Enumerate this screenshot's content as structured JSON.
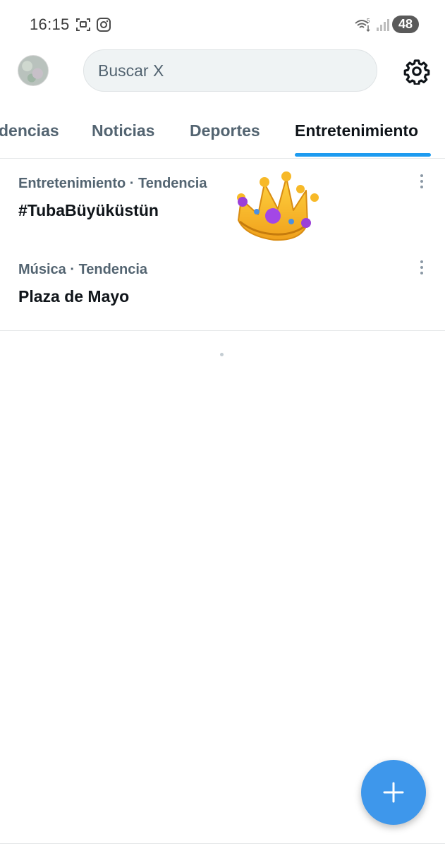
{
  "status_bar": {
    "time": "16:15",
    "battery": "48",
    "icons": [
      "screenshot-icon",
      "instagram-icon",
      "wifi-icon",
      "signal-icon"
    ]
  },
  "header": {
    "search_placeholder": "Buscar X",
    "settings_icon": "gear-icon"
  },
  "tabs": [
    {
      "label": "Tendencias",
      "visible_text": "dencias",
      "active": false
    },
    {
      "label": "Noticias",
      "visible_text": "Noticias",
      "active": false
    },
    {
      "label": "Deportes",
      "visible_text": "Deportes",
      "active": false
    },
    {
      "label": "Entretenimiento",
      "visible_text": "Entretenimiento",
      "active": true
    }
  ],
  "trends": [
    {
      "meta": "Entretenimiento · Tendencia",
      "title": "#TubaBüyüküstün"
    },
    {
      "meta": "Música · Tendencia",
      "title": "Plaza de Mayo"
    }
  ],
  "fab": {
    "icon": "plus-icon"
  },
  "colors": {
    "accent": "#1d9bf0",
    "fab": "#3e97eb",
    "secondary_text": "#536471",
    "primary_text": "#0f1419"
  }
}
